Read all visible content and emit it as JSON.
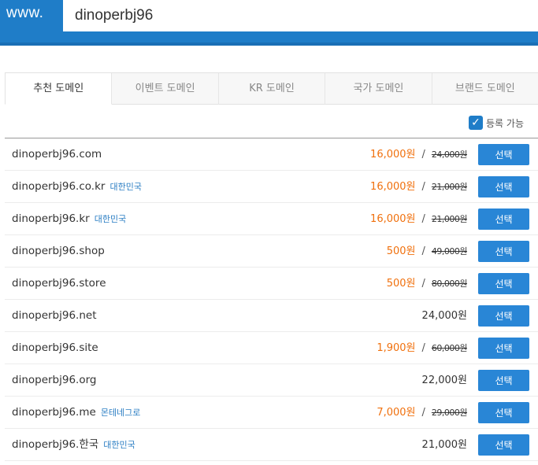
{
  "header": {
    "prefix": "www.",
    "search_value": "dinoperbj96"
  },
  "tabs": [
    {
      "label": "추천 도메인",
      "active": true
    },
    {
      "label": "이벤트 도메인",
      "active": false
    },
    {
      "label": "KR 도메인",
      "active": false
    },
    {
      "label": "국가 도메인",
      "active": false
    },
    {
      "label": "브랜드 도메인",
      "active": false
    }
  ],
  "filter": {
    "label": "등록 가능",
    "checked": true
  },
  "select_label": "선택",
  "domains": [
    {
      "name": "dinoperbj96.com",
      "country": "",
      "price": "16,000원",
      "original": "24,000원",
      "sale": true
    },
    {
      "name": "dinoperbj96.co.kr",
      "country": "대한민국",
      "price": "16,000원",
      "original": "21,000원",
      "sale": true
    },
    {
      "name": "dinoperbj96.kr",
      "country": "대한민국",
      "price": "16,000원",
      "original": "21,000원",
      "sale": true
    },
    {
      "name": "dinoperbj96.shop",
      "country": "",
      "price": "500원",
      "original": "49,000원",
      "sale": true
    },
    {
      "name": "dinoperbj96.store",
      "country": "",
      "price": "500원",
      "original": "80,000원",
      "sale": true
    },
    {
      "name": "dinoperbj96.net",
      "country": "",
      "price": "24,000원",
      "original": "",
      "sale": false
    },
    {
      "name": "dinoperbj96.site",
      "country": "",
      "price": "1,900원",
      "original": "60,000원",
      "sale": true
    },
    {
      "name": "dinoperbj96.org",
      "country": "",
      "price": "22,000원",
      "original": "",
      "sale": false
    },
    {
      "name": "dinoperbj96.me",
      "country": "몬테네그로",
      "price": "7,000원",
      "original": "29,000원",
      "sale": true
    },
    {
      "name": "dinoperbj96.한국",
      "country": "대한민국",
      "price": "21,000원",
      "original": "",
      "sale": false
    }
  ],
  "colors": {
    "brand": "#1f7dc8",
    "sale": "#f0700d",
    "country": "#2d7fc4",
    "button": "#2986d6"
  }
}
